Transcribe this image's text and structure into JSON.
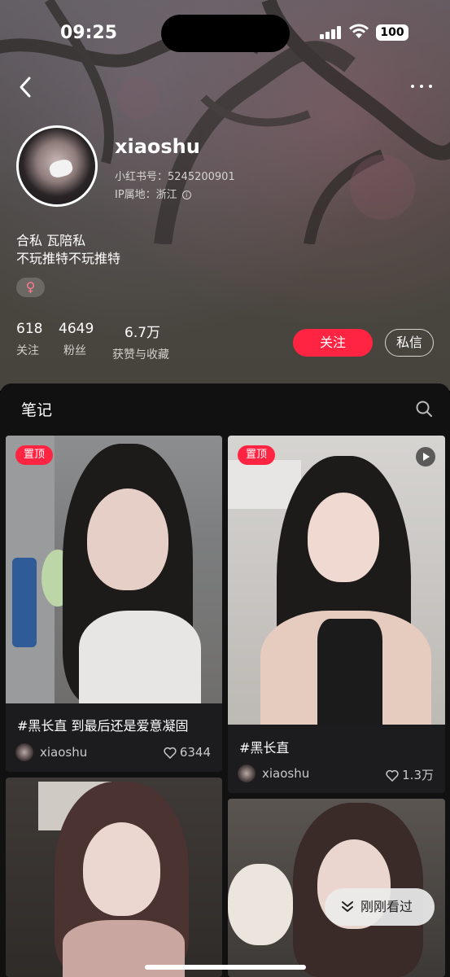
{
  "status_bar": {
    "time": "09:25",
    "battery": "100"
  },
  "profile": {
    "username": "xiaoshu",
    "red_id": "小红书号：5245200901",
    "ip": "IP属地：浙江",
    "bio_line1": "合私  瓦陪私",
    "bio_line2": "不玩推特不玩推特",
    "gender_symbol": "♀"
  },
  "stats": [
    {
      "value": "618",
      "label": "关注"
    },
    {
      "value": "4649",
      "label": "粉丝"
    },
    {
      "value": "6.7万",
      "label": "获赞与收藏"
    }
  ],
  "actions": {
    "follow": "关注",
    "message": "私信"
  },
  "notes": {
    "title": "笔记",
    "cards": [
      {
        "pinned": "置顶",
        "title": "#黑长直 到最后还是爱意凝固",
        "author": "xiaoshu",
        "likes": "6344"
      },
      {
        "pinned": "置顶",
        "title": "#黑长直",
        "author": "xiaoshu",
        "likes": "1.3万",
        "video": true
      },
      {
        "title": "",
        "author": "",
        "likes": ""
      },
      {
        "title": "",
        "author": "",
        "likes": ""
      }
    ]
  },
  "floating": {
    "recent": "刚刚看过"
  },
  "colors": {
    "accent": "#ff2442",
    "panel_bg": "#111111",
    "card_bg": "#1c1c1e"
  }
}
